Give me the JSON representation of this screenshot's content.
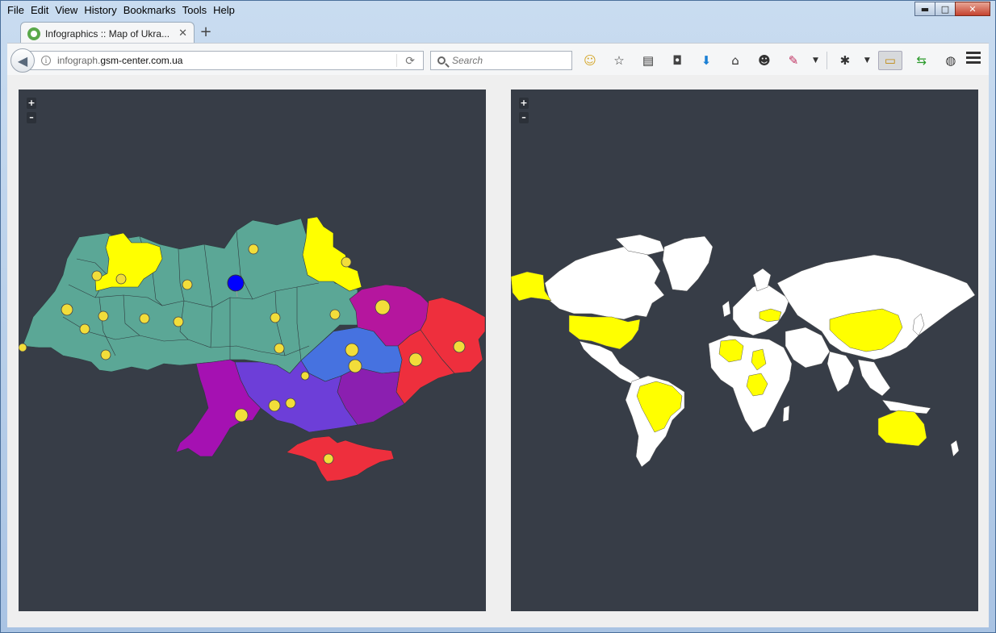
{
  "menu": [
    "File",
    "Edit",
    "View",
    "History",
    "Bookmarks",
    "Tools",
    "Help"
  ],
  "menu_underline": [
    "F",
    "E",
    "V",
    "H",
    "B",
    "T",
    "H"
  ],
  "window_controls": {
    "minimize": "▬",
    "maximize": "□",
    "close": "✕"
  },
  "tab": {
    "title": "Infographics :: Map of Ukra...",
    "close": "✕",
    "new_tab": "+"
  },
  "urlbar": {
    "prefix": "infograph.",
    "host": "gsm-center.com.ua"
  },
  "search": {
    "placeholder": "Search"
  },
  "maps": {
    "zoom_in": "+",
    "zoom_out": "–"
  },
  "colors": {
    "map_background": "#373d47",
    "ukraine_base": "#5ba796",
    "yellow": "#ffff00",
    "magenta": "#b5169e",
    "red": "#ee2f3d",
    "blue": "#4672e0",
    "violet": "#6d3ed8",
    "purple": "#a511b2",
    "marker": "#f2dd3a",
    "selected_marker": "#0000ff",
    "world_land": "#ffffff"
  }
}
